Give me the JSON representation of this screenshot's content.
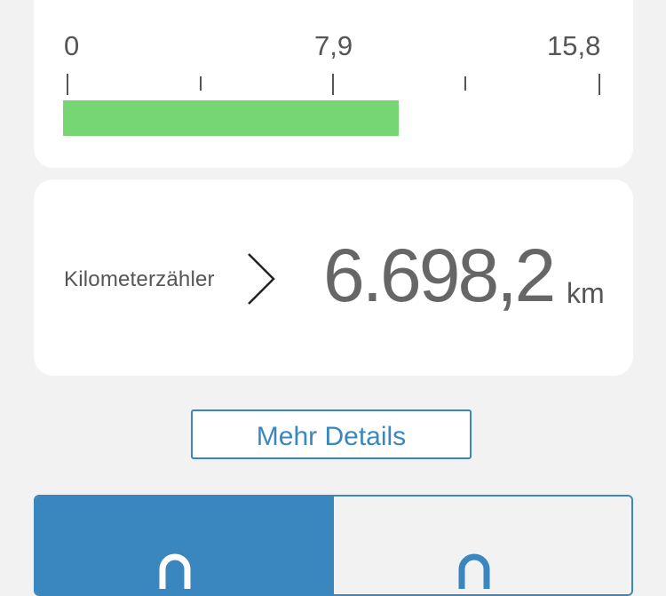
{
  "gauge": {
    "scale_labels": [
      "0",
      "7,9",
      "15,8"
    ],
    "max": 15.8,
    "fill_value": 9.9,
    "fill_color": "#77d674"
  },
  "odometer": {
    "label": "Kilometerzähler",
    "value": "6.698,2",
    "unit": "km",
    "chevron_icon": "chevron-right-icon"
  },
  "details_button": {
    "label": "Mehr Details"
  },
  "lock_tabs": {
    "accent_color": "#3a87c0",
    "items": [
      {
        "icon": "lock-icon",
        "selected": true
      },
      {
        "icon": "unlock-icon",
        "selected": false
      }
    ]
  }
}
